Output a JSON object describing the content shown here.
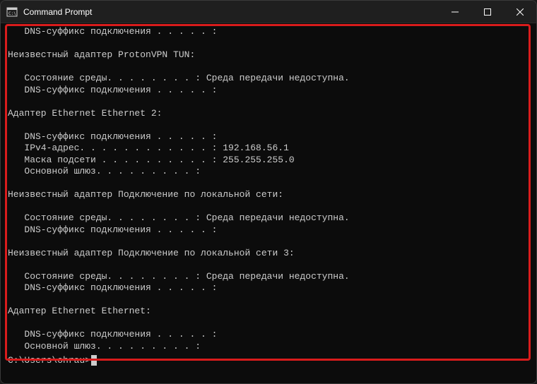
{
  "window": {
    "title": "Command Prompt"
  },
  "terminal": {
    "lines": [
      "   DNS-суффикс подключения . . . . . :",
      "",
      "Неизвестный адаптер ProtonVPN TUN:",
      "",
      "   Состояние среды. . . . . . . . : Среда передачи недоступна.",
      "   DNS-суффикс подключения . . . . . :",
      "",
      "Адаптер Ethernet Ethernet 2:",
      "",
      "   DNS-суффикс подключения . . . . . :",
      "   IPv4-адрес. . . . . . . . . . . . : 192.168.56.1",
      "   Маска подсети . . . . . . . . . . : 255.255.255.0",
      "   Основной шлюз. . . . . . . . . :",
      "",
      "Неизвестный адаптер Подключение по локальной сети:",
      "",
      "   Состояние среды. . . . . . . . : Среда передачи недоступна.",
      "   DNS-суффикс подключения . . . . . :",
      "",
      "Неизвестный адаптер Подключение по локальной сети 3:",
      "",
      "   Состояние среды. . . . . . . . : Среда передачи недоступна.",
      "   DNS-суффикс подключения . . . . . :",
      "",
      "Адаптер Ethernet Ethernet:",
      "",
      "   DNS-суффикс подключения . . . . . :",
      "   Основной шлюз. . . . . . . . . :"
    ],
    "prompt": "C:\\Users\\ohrau>"
  }
}
